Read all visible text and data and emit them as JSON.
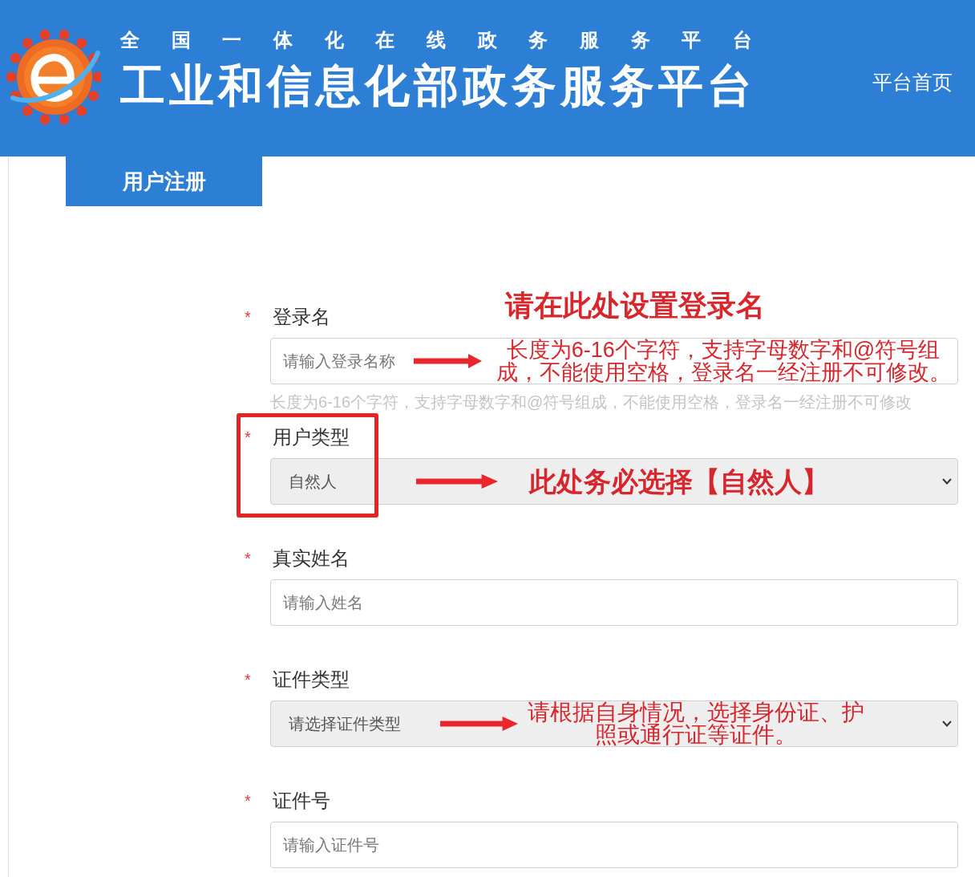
{
  "header": {
    "subtitle": "全 国 一 体 化 在 线 政 务 服 务 平 台",
    "title": "工业和信息化部政务服务平台",
    "home_link": "平台首页"
  },
  "tabs": [
    {
      "label": "用户注册",
      "selected": true
    }
  ],
  "form": {
    "fields": [
      {
        "kind": "input",
        "required_mark": "*",
        "label": "登录名",
        "placeholder": "请输入登录名称",
        "help": "长度为6-16个字符，支持字母数字和@符号组成，不能使用空格，登录名一经注册不可修改",
        "annotations": [
          {
            "kind": "title",
            "text": "请在此处设置登录名"
          },
          {
            "kind": "note",
            "text": "长度为6-16个字符，支持字母数字和@符号组成，不能使用空格，登录名一经注册不可修改。",
            "bold": false
          }
        ]
      },
      {
        "kind": "select",
        "required_mark": "*",
        "label": "用户类型",
        "value": "自然人",
        "highlighted": true,
        "annotations": [
          {
            "kind": "note",
            "text": "此处务必选择【自然人】",
            "bold": true
          }
        ]
      },
      {
        "kind": "input",
        "required_mark": "*",
        "label": "真实姓名",
        "placeholder": "请输入姓名"
      },
      {
        "kind": "select",
        "required_mark": "*",
        "label": "证件类型",
        "value": "请选择证件类型",
        "annotations": [
          {
            "kind": "note",
            "text": "请根据自身情况，选择身份证、护照或通行证等证件。",
            "bold": false
          }
        ]
      },
      {
        "kind": "input",
        "required_mark": "*",
        "label": "证件号",
        "placeholder": "请输入证件号"
      }
    ]
  }
}
